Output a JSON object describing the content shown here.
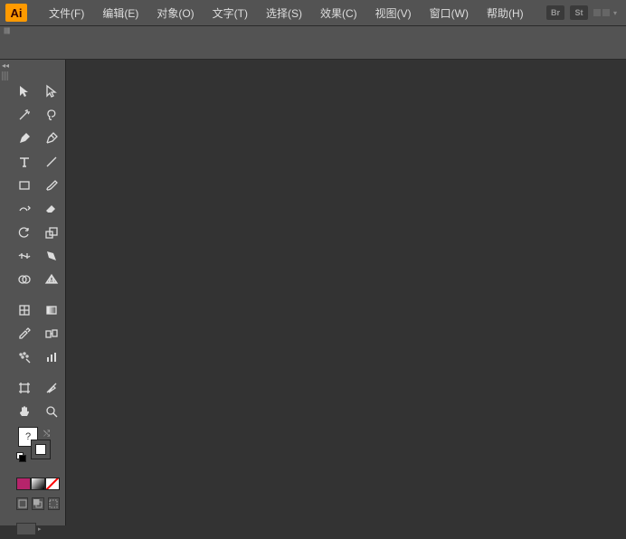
{
  "app": {
    "logo": "Ai"
  },
  "menu": {
    "items": [
      {
        "label": "文件(F)"
      },
      {
        "label": "编辑(E)"
      },
      {
        "label": "对象(O)"
      },
      {
        "label": "文字(T)"
      },
      {
        "label": "选择(S)"
      },
      {
        "label": "效果(C)"
      },
      {
        "label": "视图(V)"
      },
      {
        "label": "窗口(W)"
      },
      {
        "label": "帮助(H)"
      }
    ]
  },
  "badges": {
    "bridge": "Br",
    "stock": "St"
  },
  "toolbox": {
    "rows": [
      [
        "selection-tool",
        "direct-selection-tool"
      ],
      [
        "magic-wand-tool",
        "lasso-tool"
      ],
      [
        "pen-tool",
        "curvature-tool"
      ],
      [
        "type-tool",
        "line-segment-tool"
      ],
      [
        "rectangle-tool",
        "paintbrush-tool"
      ],
      [
        "shaper-tool",
        "eraser-tool"
      ],
      [
        "rotate-tool",
        "scale-tool"
      ],
      [
        "width-tool",
        "free-transform-tool"
      ],
      [
        "shape-builder-tool",
        "perspective-grid-tool"
      ],
      [
        "mesh-tool",
        "gradient-tool"
      ],
      [
        "eyedropper-tool",
        "blend-tool"
      ],
      [
        "symbol-sprayer-tool",
        "column-graph-tool"
      ],
      [
        "artboard-tool",
        "slice-tool"
      ],
      [
        "hand-tool",
        "zoom-tool"
      ]
    ]
  },
  "fillstroke": {
    "unknown": "?"
  },
  "colors": {
    "accent": "#ff9a00",
    "panel": "#535353",
    "canvas": "#333333"
  }
}
